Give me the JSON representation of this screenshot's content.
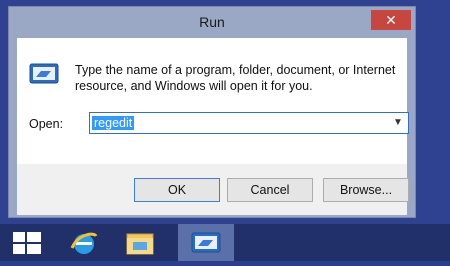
{
  "window": {
    "title": "Run",
    "close_icon": "close-icon",
    "prompt": "Type the name of a program, folder, document, or Internet resource, and Windows will open it for you.",
    "open_label": "Open:",
    "open_value": "regedit",
    "buttons": {
      "ok": "OK",
      "cancel": "Cancel",
      "browse": "Browse..."
    }
  },
  "taskbar": {
    "items": [
      {
        "icon": "windows-start-icon"
      },
      {
        "icon": "internet-explorer-icon"
      },
      {
        "icon": "file-explorer-icon"
      },
      {
        "icon": "run-dialog-icon",
        "active": true
      }
    ]
  },
  "colors": {
    "desktop": "#2f4292",
    "window_frame": "#9aa8c6",
    "close_button": "#c7463f",
    "selection": "#3399ff",
    "taskbar": "#22306a"
  }
}
